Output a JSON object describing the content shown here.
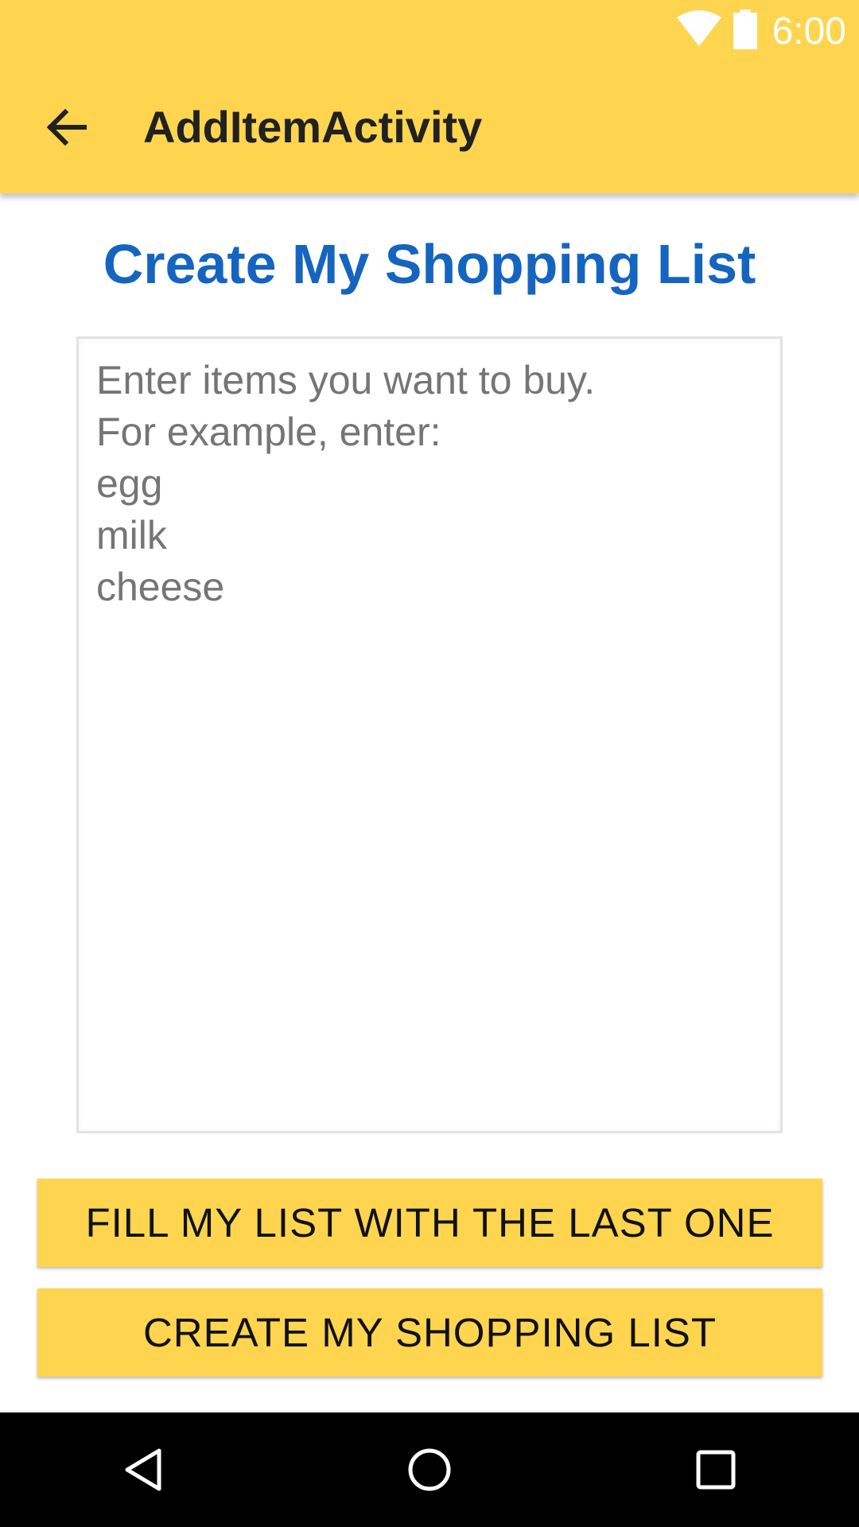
{
  "status_bar": {
    "time": "6:00",
    "icons": [
      "wifi-icon",
      "battery-icon"
    ]
  },
  "app_bar": {
    "title": "AddItemActivity",
    "back_icon": "arrow-back-icon"
  },
  "main": {
    "heading": "Create My Shopping List",
    "items_input": {
      "value": "",
      "placeholder": "Enter items you want to buy.\nFor example, enter:\negg\nmilk\ncheese"
    },
    "fill_button_label": "FILL MY LIST WITH THE LAST ONE",
    "create_button_label": "CREATE MY SHOPPING LIST"
  },
  "nav_bar": {
    "icons": [
      "nav-back-icon",
      "nav-home-icon",
      "nav-recents-icon"
    ]
  },
  "colors": {
    "accent": "#FFD54F",
    "heading": "#1565C0",
    "nav_bar": "#000000"
  }
}
